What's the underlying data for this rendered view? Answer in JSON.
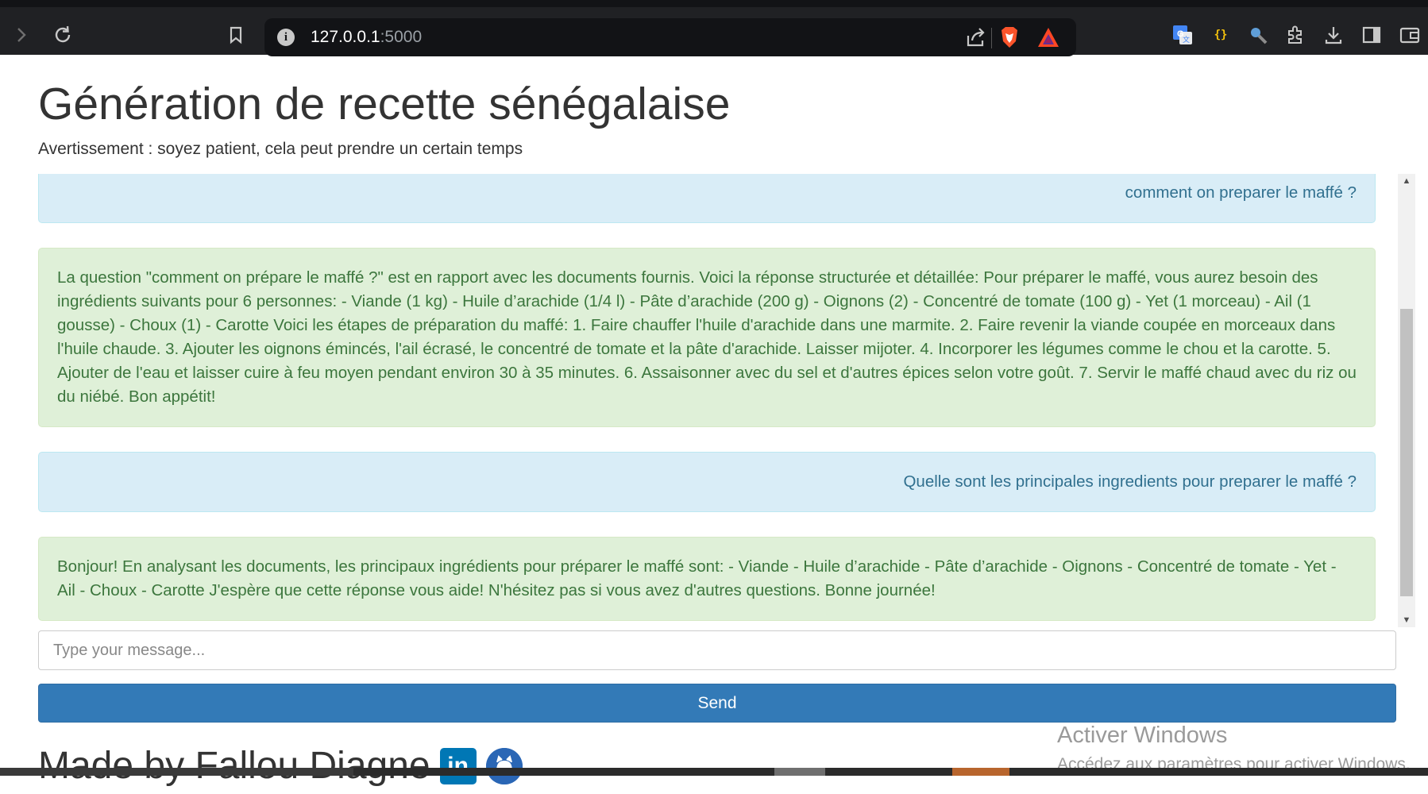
{
  "browser": {
    "url_host": "127.0.0.1",
    "url_port": ":5000",
    "icons": [
      "forward-icon",
      "reload-icon",
      "bookmark-icon",
      "info-icon",
      "share-icon",
      "brave-shield-icon",
      "brave-rewards-icon",
      "translate-icon",
      "json-viewer-icon",
      "extension-search-icon",
      "extensions-icon",
      "download-icon",
      "sidebar-icon",
      "wallet-icon"
    ]
  },
  "page": {
    "title": "Génération de recette sénégalaise",
    "warning": "Avertissement : soyez patient, cela peut prendre un certain temps"
  },
  "chat": {
    "messages": [
      {
        "role": "user",
        "text": "comment on preparer le maffé ?"
      },
      {
        "role": "bot",
        "text": "La question \"comment on prépare le maffé ?\" est en rapport avec les documents fournis. Voici la réponse structurée et détaillée: Pour préparer le maffé, vous aurez besoin des ingrédients suivants pour 6 personnes: - Viande (1 kg) - Huile d’arachide (1/4 l) - Pâte d’arachide (200 g) - Oignons (2) - Concentré de tomate (100 g) - Yet (1 morceau) - Ail (1 gousse) - Choux (1) - Carotte Voici les étapes de préparation du maffé: 1. Faire chauffer l'huile d'arachide dans une marmite. 2. Faire revenir la viande coupée en morceaux dans l'huile chaude. 3. Ajouter les oignons émincés, l'ail écrasé, le concentré de tomate et la pâte d'arachide. Laisser mijoter. 4. Incorporer les légumes comme le chou et la carotte. 5. Ajouter de l'eau et laisser cuire à feu moyen pendant environ 30 à 35 minutes. 6. Assaisonner avec du sel et d'autres épices selon votre goût. 7. Servir le maffé chaud avec du riz ou du niébé. Bon appétit!"
      },
      {
        "role": "user",
        "text": "Quelle sont les principales ingredients pour preparer le maffé ?"
      },
      {
        "role": "bot",
        "text": "Bonjour! En analysant les documents, les principaux ingrédients pour préparer le maffé sont: - Viande - Huile d’arachide - Pâte d’arachide - Oignons - Concentré de tomate - Yet - Ail - Choux - Carotte J'espère que cette réponse vous aide! N'hésitez pas si vous avez d'autres questions. Bonne journée!"
      }
    ],
    "input_placeholder": "Type your message...",
    "input_value": "",
    "send_label": "Send"
  },
  "footer": {
    "text": "Made by Fallou Diagne",
    "linkedin_glyph": "in"
  },
  "watermark": {
    "line1": "Activer Windows",
    "line2": "Accédez aux paramètres pour activer Windows."
  },
  "colors": {
    "user_bg": "#d9edf7",
    "user_text": "#31708f",
    "bot_bg": "#dff0d8",
    "bot_text": "#3c763d",
    "send_bg": "#337ab7"
  }
}
